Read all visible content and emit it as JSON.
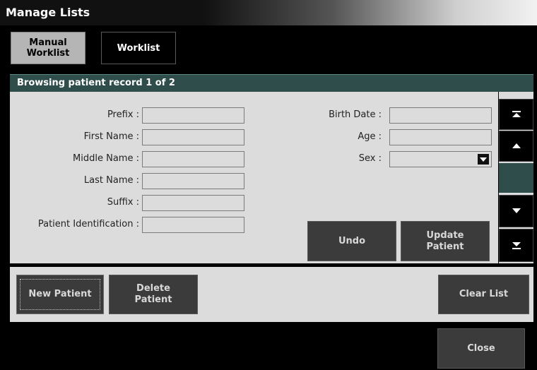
{
  "window": {
    "title": "Manage Lists"
  },
  "tabs": [
    {
      "label": "Manual\nWorklist",
      "active": true
    },
    {
      "label": "Worklist",
      "active": false
    }
  ],
  "header": {
    "text": "Browsing patient record 1 of 2"
  },
  "form": {
    "prefix": {
      "label": "Prefix :",
      "value": ""
    },
    "first_name": {
      "label": "First Name :",
      "value": ""
    },
    "middle_name": {
      "label": "Middle Name :",
      "value": ""
    },
    "last_name": {
      "label": "Last Name :",
      "value": ""
    },
    "suffix": {
      "label": "Suffix :",
      "value": ""
    },
    "patient_id": {
      "label": "Patient Identification :",
      "value": ""
    },
    "birth_date": {
      "label": "Birth Date :",
      "value": ""
    },
    "age": {
      "label": "Age :",
      "value": ""
    },
    "sex": {
      "label": "Sex :",
      "value": ""
    }
  },
  "buttons": {
    "undo": "Undo",
    "update_patient": "Update\nPatient",
    "new_patient": "New Patient",
    "delete_patient": "Delete\nPatient",
    "clear_list": "Clear List",
    "close": "Close"
  },
  "scroll": {
    "top_icon": "scroll-to-top-icon",
    "up_icon": "scroll-up-icon",
    "down_icon": "scroll-down-icon",
    "bottom_icon": "scroll-to-bottom-icon"
  },
  "colors": {
    "header_bg": "#2f4e4b",
    "panel_bg": "#dcdcdc",
    "button_bg": "#3b3b3b",
    "active_tab_bg": "#b5b5b5"
  }
}
